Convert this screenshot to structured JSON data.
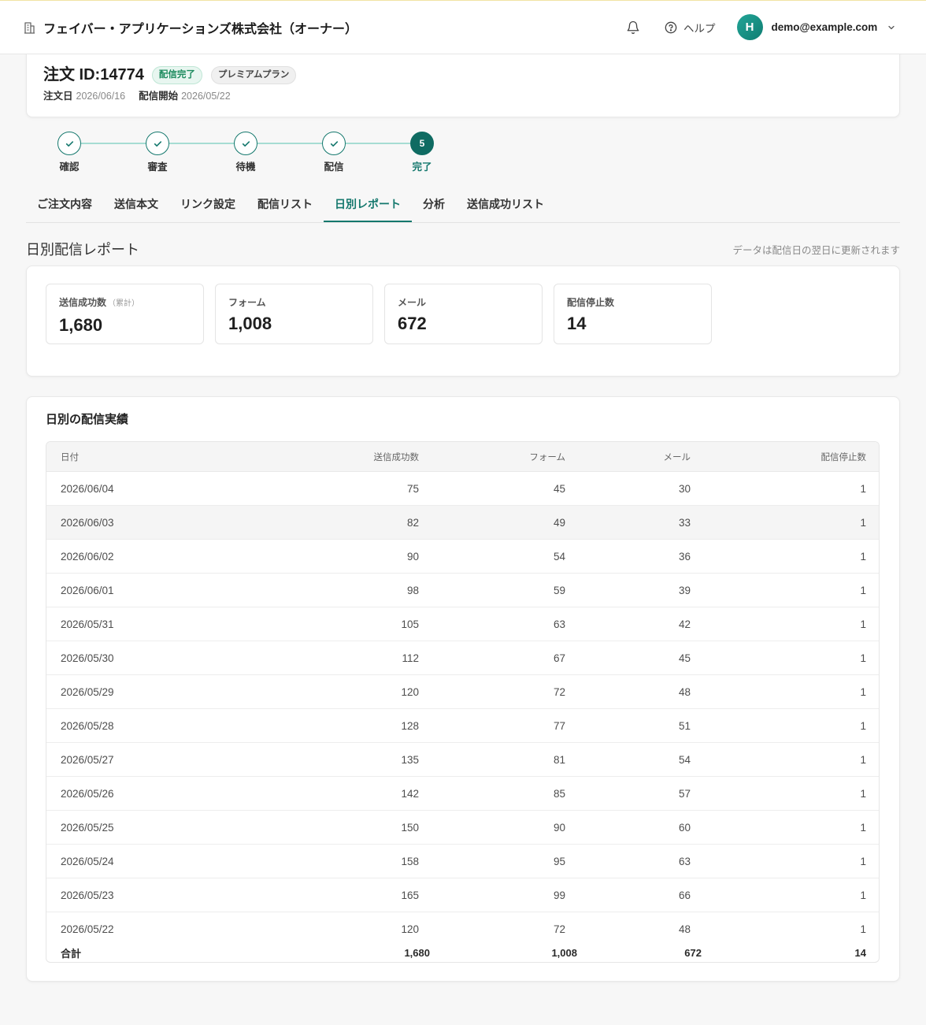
{
  "colors": {
    "accent": "#14786d",
    "accent_dark": "#0f6b62",
    "step_line": "#a6dcd3",
    "status_badge_text": "#1b8a5d",
    "status_badge_bg": "#e8f6f0",
    "avatar": "#0f7d72",
    "page_bg": "#f7f7f7",
    "top_bar": "#f1e4a3"
  },
  "header": {
    "company_icon": "building-icon",
    "company_name": "フェイバー・アプリケーションズ株式会社（オーナー）",
    "notification_icon": "bell-icon",
    "help_icon": "help-circle-icon",
    "help_label": "ヘルプ",
    "avatar_initial": "H",
    "user_email": "demo@example.com",
    "menu_icon": "chevron-down-icon"
  },
  "order": {
    "title": "注文 ID:14774",
    "status_badge": "配信完了",
    "plan_badge": "プレミアムプラン",
    "order_date_label": "注文日",
    "order_date": "2026/06/16",
    "start_date_label": "配信開始",
    "start_date": "2026/05/22"
  },
  "stepper": {
    "current_step_index": 4,
    "done_icon": "check-icon",
    "steps": [
      {
        "label": "確認"
      },
      {
        "label": "審査"
      },
      {
        "label": "待機"
      },
      {
        "label": "配信"
      },
      {
        "label": "完了",
        "number": "5"
      }
    ]
  },
  "active_tab_index": 4,
  "tabs": [
    {
      "label": "ご注文内容"
    },
    {
      "label": "送信本文"
    },
    {
      "label": "リンク設定"
    },
    {
      "label": "配信リスト"
    },
    {
      "label": "日別レポート"
    },
    {
      "label": "分析"
    },
    {
      "label": "送信成功リスト"
    }
  ],
  "report": {
    "title": "日別配信レポート",
    "note": "データは配信日の翌日に更新されます"
  },
  "stats": [
    {
      "label": "送信成功数",
      "sub_label": "（累計）",
      "value": "1,680"
    },
    {
      "label": "フォーム",
      "value": "1,008"
    },
    {
      "label": "メール",
      "value": "672"
    },
    {
      "label": "配信停止数",
      "value": "14"
    }
  ],
  "daily": {
    "title": "日別の配信実績",
    "columns": [
      "日付",
      "送信成功数",
      "フォーム",
      "メール",
      "配信停止数"
    ],
    "hover_row_index": 1,
    "rows": [
      {
        "date": "2026/06/04",
        "sent": 75,
        "form": 45,
        "mail": 30,
        "unsubscribed": 1
      },
      {
        "date": "2026/06/03",
        "sent": 82,
        "form": 49,
        "mail": 33,
        "unsubscribed": 1
      },
      {
        "date": "2026/06/02",
        "sent": 90,
        "form": 54,
        "mail": 36,
        "unsubscribed": 1
      },
      {
        "date": "2026/06/01",
        "sent": 98,
        "form": 59,
        "mail": 39,
        "unsubscribed": 1
      },
      {
        "date": "2026/05/31",
        "sent": 105,
        "form": 63,
        "mail": 42,
        "unsubscribed": 1
      },
      {
        "date": "2026/05/30",
        "sent": 112,
        "form": 67,
        "mail": 45,
        "unsubscribed": 1
      },
      {
        "date": "2026/05/29",
        "sent": 120,
        "form": 72,
        "mail": 48,
        "unsubscribed": 1
      },
      {
        "date": "2026/05/28",
        "sent": 128,
        "form": 77,
        "mail": 51,
        "unsubscribed": 1
      },
      {
        "date": "2026/05/27",
        "sent": 135,
        "form": 81,
        "mail": 54,
        "unsubscribed": 1
      },
      {
        "date": "2026/05/26",
        "sent": 142,
        "form": 85,
        "mail": 57,
        "unsubscribed": 1
      },
      {
        "date": "2026/05/25",
        "sent": 150,
        "form": 90,
        "mail": 60,
        "unsubscribed": 1
      },
      {
        "date": "2026/05/24",
        "sent": 158,
        "form": 95,
        "mail": 63,
        "unsubscribed": 1
      },
      {
        "date": "2026/05/23",
        "sent": 165,
        "form": 99,
        "mail": 66,
        "unsubscribed": 1
      },
      {
        "date": "2026/05/22",
        "sent": 120,
        "form": 72,
        "mail": 48,
        "unsubscribed": 1
      }
    ],
    "total": {
      "label": "合計",
      "sent": "1,680",
      "form": "1,008",
      "mail": "672",
      "unsubscribed": "14"
    }
  }
}
